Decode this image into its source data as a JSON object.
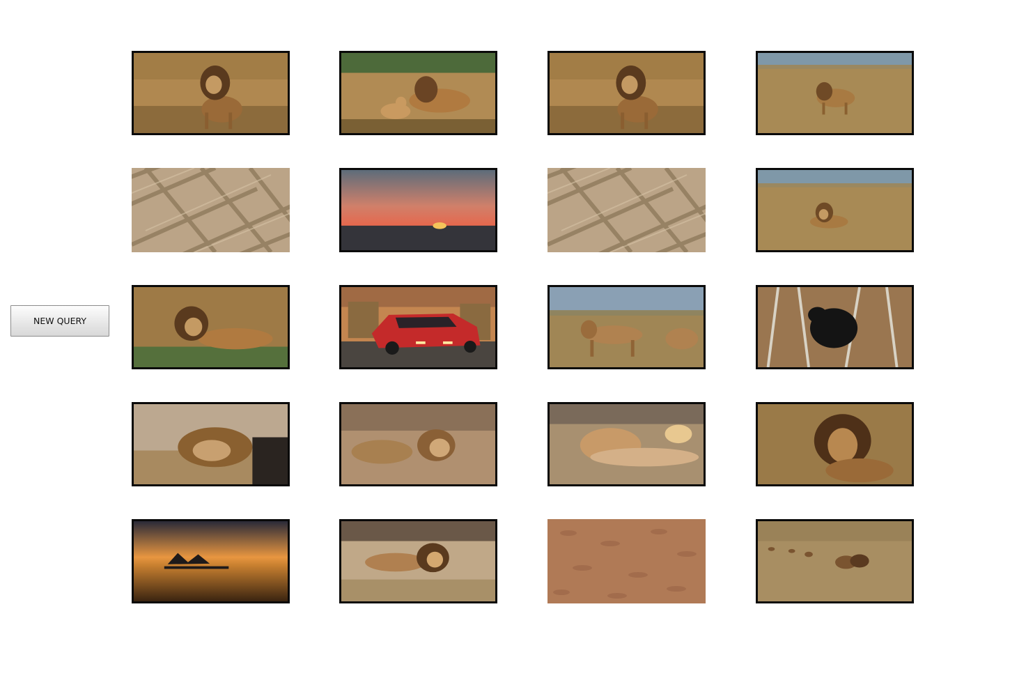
{
  "query_panel": {
    "new_query_label": "NEW QUERY"
  },
  "results": [
    {
      "row": 1,
      "col": 1,
      "subject": "lion-standing-grass",
      "frame": "black"
    },
    {
      "row": 1,
      "col": 2,
      "subject": "lion-and-lioness",
      "frame": "black"
    },
    {
      "row": 1,
      "col": 3,
      "subject": "lion-standing-grass",
      "frame": "black"
    },
    {
      "row": 1,
      "col": 4,
      "subject": "lion-walking-savanna",
      "frame": "black"
    },
    {
      "row": 2,
      "col": 1,
      "subject": "woven-rope-texture",
      "frame": "none"
    },
    {
      "row": 2,
      "col": 2,
      "subject": "sunset-over-sea",
      "frame": "black"
    },
    {
      "row": 2,
      "col": 3,
      "subject": "woven-rope-texture",
      "frame": "none"
    },
    {
      "row": 2,
      "col": 4,
      "subject": "lion-lying-savanna",
      "frame": "black"
    },
    {
      "row": 3,
      "col": 1,
      "subject": "lion-lying-grass",
      "frame": "black"
    },
    {
      "row": 3,
      "col": 2,
      "subject": "red-sports-car",
      "frame": "black"
    },
    {
      "row": 3,
      "col": 3,
      "subject": "two-lions-savanna",
      "frame": "black"
    },
    {
      "row": 3,
      "col": 4,
      "subject": "black-bear-trees",
      "frame": "black"
    },
    {
      "row": 4,
      "col": 1,
      "subject": "lion-sleeping-rocks",
      "frame": "black"
    },
    {
      "row": 4,
      "col": 2,
      "subject": "lion-resting-brush",
      "frame": "black"
    },
    {
      "row": 4,
      "col": 3,
      "subject": "lioness-lying",
      "frame": "black"
    },
    {
      "row": 4,
      "col": 4,
      "subject": "lion-portrait-grass",
      "frame": "black"
    },
    {
      "row": 5,
      "col": 1,
      "subject": "sunset-boat-water",
      "frame": "black"
    },
    {
      "row": 5,
      "col": 2,
      "subject": "lion-lying-rocks",
      "frame": "black"
    },
    {
      "row": 5,
      "col": 3,
      "subject": "sand-texture",
      "frame": "none"
    },
    {
      "row": 5,
      "col": 4,
      "subject": "lion-pride-walking",
      "frame": "black"
    }
  ]
}
